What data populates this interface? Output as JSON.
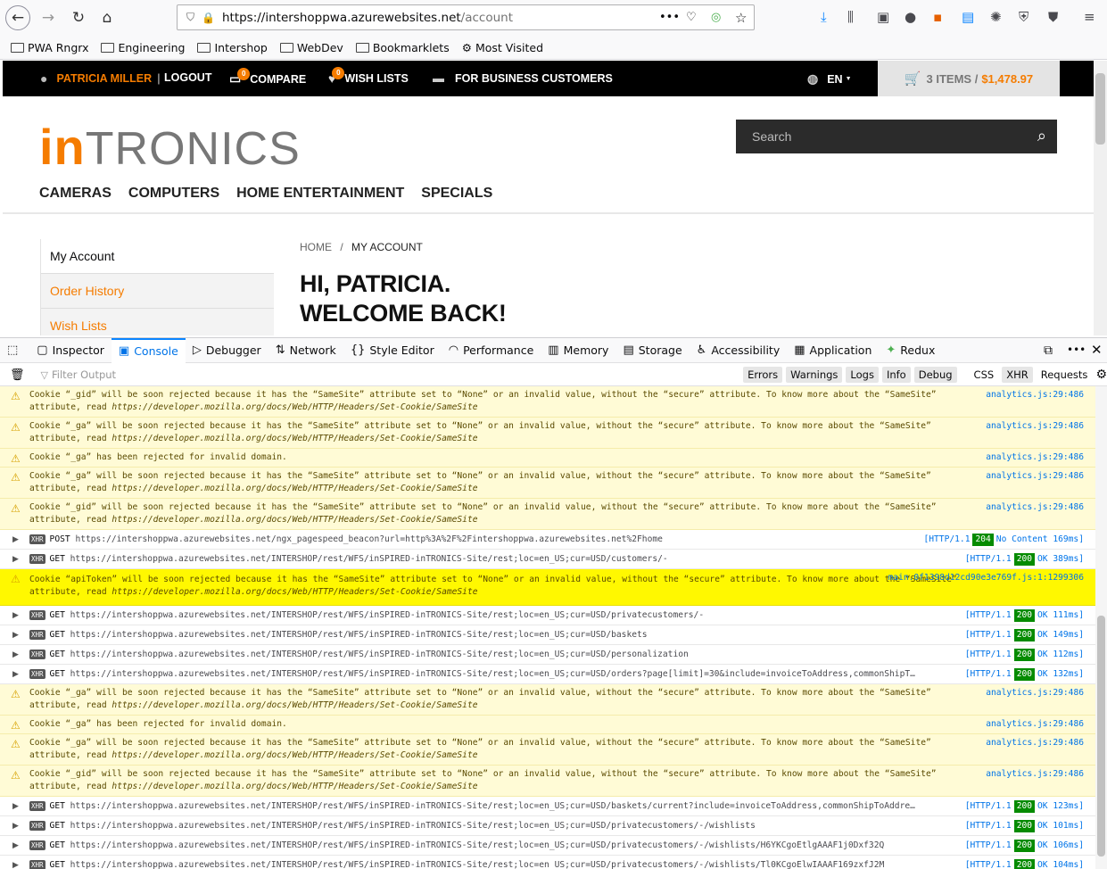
{
  "browser": {
    "url_host": "https://intershoppwa.azurewebsites.net",
    "url_path": "/account",
    "bookmarks": [
      "PWA Rngrx",
      "Engineering",
      "Intershop",
      "WebDev",
      "Bookmarklets",
      "Most Visited"
    ]
  },
  "site": {
    "topbar": {
      "user": "PATRICIA MILLER",
      "separator": "|",
      "logout": "LOGOUT",
      "compare": "COMPARE",
      "compare_count": "0",
      "wishlists": "WISH LISTS",
      "wishlist_count": "0",
      "business": "FOR BUSINESS CUSTOMERS",
      "lang": "EN",
      "cart_items": "3 ITEMS /",
      "cart_total": "$1,478.97"
    },
    "logo_in": "in",
    "logo_tronics": "TRONICS",
    "search_placeholder": "Search",
    "categories": [
      "CAMERAS",
      "COMPUTERS",
      "HOME ENTERTAINMENT",
      "SPECIALS"
    ],
    "side_nav": [
      "My Account",
      "Order History",
      "Wish Lists"
    ],
    "breadcrumb_home": "HOME",
    "breadcrumb_sep": "/",
    "breadcrumb_current": "MY ACCOUNT",
    "welcome_line1": "HI, PATRICIA.",
    "welcome_line2": "WELCOME BACK!"
  },
  "devtools": {
    "tabs": [
      "Inspector",
      "Console",
      "Debugger",
      "Network",
      "Style Editor",
      "Performance",
      "Memory",
      "Storage",
      "Accessibility",
      "Application",
      "Redux"
    ],
    "filter_placeholder": "Filter Output",
    "filters": [
      "Errors",
      "Warnings",
      "Logs",
      "Info",
      "Debug",
      "CSS",
      "XHR",
      "Requests"
    ],
    "colors": {
      "warning_bg": "#fffbd6",
      "highlight": "#fff800",
      "status_ok": "#058b00",
      "accent": "#f57c00"
    },
    "rows": [
      {
        "type": "warn",
        "text": "Cookie “_gid” will be soon rejected because it has the “SameSite” attribute set to “None” or an invalid value, without the “secure” attribute. To know more about the “SameSite” attribute, read ",
        "link": "https://developer.mozilla.org/docs/Web/HTTP/Headers/Set-Cookie/SameSite",
        "src": "analytics.js:29:486"
      },
      {
        "type": "warn",
        "text": "Cookie “_ga” will be soon rejected because it has the “SameSite” attribute set to “None” or an invalid value, without the “secure” attribute. To know more about the “SameSite” attribute, read ",
        "link": "https://developer.mozilla.org/docs/Web/HTTP/Headers/Set-Cookie/SameSite",
        "src": "analytics.js:29:486"
      },
      {
        "type": "warn1",
        "text": "Cookie “_ga” has been rejected for invalid domain.",
        "link": "",
        "src": "analytics.js:29:486"
      },
      {
        "type": "warn",
        "text": "Cookie “_ga” will be soon rejected because it has the “SameSite” attribute set to “None” or an invalid value, without the “secure” attribute. To know more about the “SameSite” attribute, read ",
        "link": "https://developer.mozilla.org/docs/Web/HTTP/Headers/Set-Cookie/SameSite",
        "src": "analytics.js:29:486"
      },
      {
        "type": "warn",
        "text": "Cookie “_gid” will be soon rejected because it has the “SameSite” attribute set to “None” or an invalid value, without the “secure” attribute. To know more about the “SameSite” attribute, read ",
        "link": "https://developer.mozilla.org/docs/Web/HTTP/Headers/Set-Cookie/SameSite",
        "src": "analytics.js:29:486"
      },
      {
        "type": "net",
        "method": "POST",
        "url": "https://intershoppwa.azurewebsites.net/ngx_pagespeed_beacon?url=http%3A%2F%2Fintershoppwa.azurewebsites.net%2Fhome",
        "proto": "[HTTP/1.1",
        "code": "204",
        "msg": "No Content 169ms]"
      },
      {
        "type": "net",
        "method": "GET",
        "url": "https://intershoppwa.azurewebsites.net/INTERSHOP/rest/WFS/inSPIRED-inTRONICS-Site/rest;loc=en_US;cur=USD/customers/-",
        "proto": "[HTTP/1.1",
        "code": "200",
        "msg": "OK 389ms]"
      },
      {
        "type": "hl",
        "text": "Cookie “apiToken” will be soon rejected because it has the “SameSite” attribute set to “None” or an invalid value, without the “secure” attribute. To know more about the “SameSite” attribute, read ",
        "link": "https://developer.mozilla.org/docs/Web/HTTP/Headers/Set-Cookie/SameSite",
        "src": "main.0f1398d12cd90e3e769f.js:1:1299306"
      },
      {
        "type": "net",
        "method": "GET",
        "url": "https://intershoppwa.azurewebsites.net/INTERSHOP/rest/WFS/inSPIRED-inTRONICS-Site/rest;loc=en_US;cur=USD/privatecustomers/-",
        "proto": "[HTTP/1.1",
        "code": "200",
        "msg": "OK 111ms]"
      },
      {
        "type": "net",
        "method": "GET",
        "url": "https://intershoppwa.azurewebsites.net/INTERSHOP/rest/WFS/inSPIRED-inTRONICS-Site/rest;loc=en_US;cur=USD/baskets",
        "proto": "[HTTP/1.1",
        "code": "200",
        "msg": "OK 149ms]"
      },
      {
        "type": "net",
        "method": "GET",
        "url": "https://intershoppwa.azurewebsites.net/INTERSHOP/rest/WFS/inSPIRED-inTRONICS-Site/rest;loc=en_US;cur=USD/personalization",
        "proto": "[HTTP/1.1",
        "code": "200",
        "msg": "OK 112ms]"
      },
      {
        "type": "net",
        "method": "GET",
        "url": "https://intershoppwa.azurewebsites.net/INTERSHOP/rest/WFS/inSPIRED-inTRONICS-Site/rest;loc=en_US;cur=USD/orders?page[limit]=30&include=invoiceToAddress,commonShipT…",
        "proto": "[HTTP/1.1",
        "code": "200",
        "msg": "OK 132ms]"
      },
      {
        "type": "warn",
        "text": "Cookie “_ga” will be soon rejected because it has the “SameSite” attribute set to “None” or an invalid value, without the “secure” attribute. To know more about the “SameSite” attribute, read ",
        "link": "https://developer.mozilla.org/docs/Web/HTTP/Headers/Set-Cookie/SameSite",
        "src": "analytics.js:29:486"
      },
      {
        "type": "warn1",
        "text": "Cookie “_ga” has been rejected for invalid domain.",
        "link": "",
        "src": "analytics.js:29:486"
      },
      {
        "type": "warn",
        "text": "Cookie “_ga” will be soon rejected because it has the “SameSite” attribute set to “None” or an invalid value, without the “secure” attribute. To know more about the “SameSite” attribute, read ",
        "link": "https://developer.mozilla.org/docs/Web/HTTP/Headers/Set-Cookie/SameSite",
        "src": "analytics.js:29:486"
      },
      {
        "type": "warn",
        "text": "Cookie “_gid” will be soon rejected because it has the “SameSite” attribute set to “None” or an invalid value, without the “secure” attribute. To know more about the “SameSite” attribute, read ",
        "link": "https://developer.mozilla.org/docs/Web/HTTP/Headers/Set-Cookie/SameSite",
        "src": "analytics.js:29:486"
      },
      {
        "type": "net",
        "method": "GET",
        "url": "https://intershoppwa.azurewebsites.net/INTERSHOP/rest/WFS/inSPIRED-inTRONICS-Site/rest;loc=en_US;cur=USD/baskets/current?include=invoiceToAddress,commonShipToAddre…",
        "proto": "[HTTP/1.1",
        "code": "200",
        "msg": "OK 123ms]"
      },
      {
        "type": "net",
        "method": "GET",
        "url": "https://intershoppwa.azurewebsites.net/INTERSHOP/rest/WFS/inSPIRED-inTRONICS-Site/rest;loc=en_US;cur=USD/privatecustomers/-/wishlists",
        "proto": "[HTTP/1.1",
        "code": "200",
        "msg": "OK 101ms]"
      },
      {
        "type": "net",
        "method": "GET",
        "url": "https://intershoppwa.azurewebsites.net/INTERSHOP/rest/WFS/inSPIRED-inTRONICS-Site/rest;loc=en_US;cur=USD/privatecustomers/-/wishlists/H6YKCgoEtlgAAAF1j0Dxf32Q",
        "proto": "[HTTP/1.1",
        "code": "200",
        "msg": "OK 106ms]"
      },
      {
        "type": "net",
        "method": "GET",
        "url": "https://intershoppwa.azurewebsites.net/INTERSHOP/rest/WFS/inSPIRED-inTRONICS-Site/rest;loc=en_US;cur=USD/privatecustomers/-/wishlists/Tl0KCgoElwIAAAF169zxfJ2M",
        "proto": "[HTTP/1.1",
        "code": "200",
        "msg": "OK 104ms]"
      }
    ]
  }
}
